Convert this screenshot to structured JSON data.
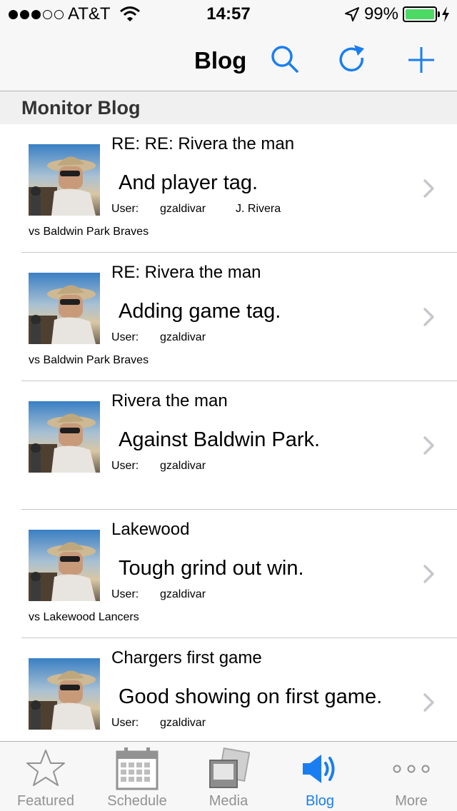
{
  "status_bar": {
    "carrier": "AT&T",
    "signal_bars_filled": 3,
    "signal_bars_total": 5,
    "time": "14:57",
    "battery_percent": "99%",
    "battery_level": 0.99
  },
  "nav": {
    "title": "Blog",
    "icons": [
      "search-icon",
      "refresh-icon",
      "add-icon"
    ]
  },
  "section": {
    "title": "Monitor Blog"
  },
  "posts": [
    {
      "title": "RE: RE: Rivera the man",
      "snippet": "And player tag.",
      "user_label": "User:",
      "user": "gzaldivar",
      "player": "J. Rivera",
      "opponent": "vs Baldwin Park Braves"
    },
    {
      "title": "RE: Rivera the man",
      "snippet": "Adding game tag.",
      "user_label": "User:",
      "user": "gzaldivar",
      "player": "",
      "opponent": "vs Baldwin Park Braves"
    },
    {
      "title": "Rivera the man",
      "snippet": "Against Baldwin Park.",
      "user_label": "User:",
      "user": "gzaldivar",
      "player": "",
      "opponent": ""
    },
    {
      "title": "Lakewood",
      "snippet": "Tough grind out win.",
      "user_label": "User:",
      "user": "gzaldivar",
      "player": "",
      "opponent": "vs Lakewood Lancers"
    },
    {
      "title": "Chargers first game",
      "snippet": "Good showing on first game.",
      "user_label": "User:",
      "user": "gzaldivar",
      "player": "",
      "opponent": ""
    }
  ],
  "tabs": [
    {
      "label": "Featured",
      "icon": "star-icon",
      "active": false
    },
    {
      "label": "Schedule",
      "icon": "calendar-icon",
      "active": false
    },
    {
      "label": "Media",
      "icon": "media-icon",
      "active": false
    },
    {
      "label": "Blog",
      "icon": "megaphone-icon",
      "active": true
    },
    {
      "label": "More",
      "icon": "more-icon",
      "active": false
    }
  ],
  "colors": {
    "accent": "#1a7ef0",
    "inactive_tab": "#929292",
    "battery_fill": "#4cd964",
    "bar_background": "#f7f7f7",
    "section_background": "#f0f0f0"
  }
}
